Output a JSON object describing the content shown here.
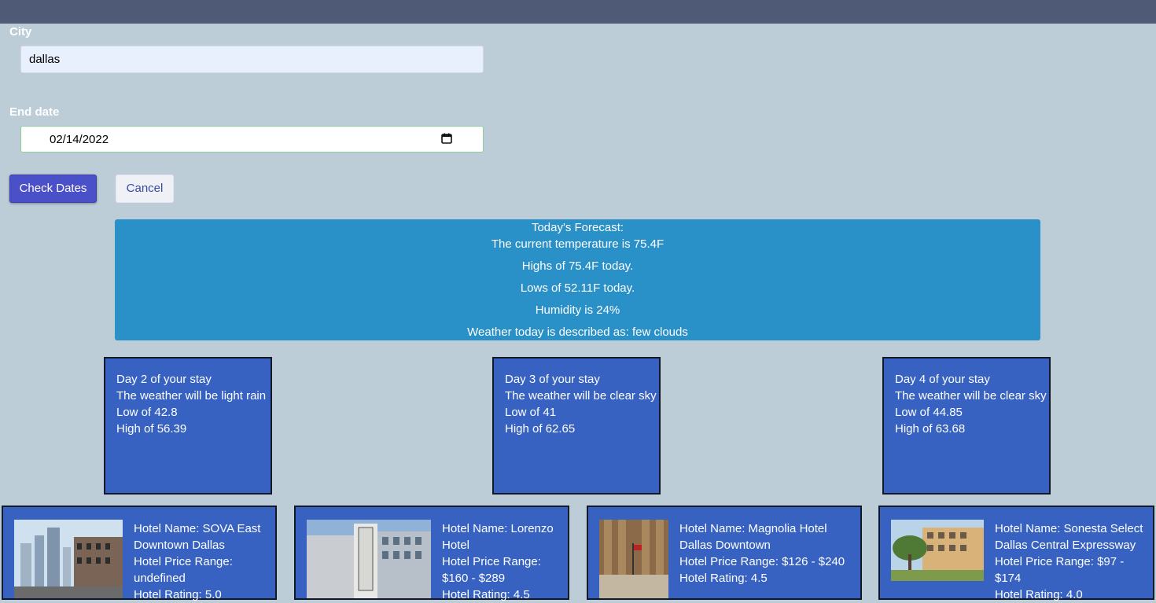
{
  "form": {
    "city_label": "City",
    "city_value": "dallas",
    "end_date_label": "End date",
    "end_date_value": "02/14/2022",
    "check_button": "Check Dates",
    "cancel_button": "Cancel"
  },
  "forecast": {
    "title": "Today's Forecast:",
    "current": "The current temperature is 75.4F",
    "highs": "Highs of 75.4F today.",
    "lows": "Lows of 52.11F today.",
    "humidity": "Humidity is 24%",
    "description": "Weather today is described as: few clouds"
  },
  "days": [
    {
      "title": "Day 2 of your stay",
      "weather": "The weather will be light rain",
      "low": "Low of 42.8",
      "high": "High of 56.39"
    },
    {
      "title": "Day 3 of your stay",
      "weather": "The weather will be clear sky",
      "low": "Low of 41",
      "high": "High of 62.65"
    },
    {
      "title": "Day 4 of your stay",
      "weather": "The weather will be clear sky",
      "low": "Low of 44.85",
      "high": "High of 63.68"
    }
  ],
  "hotels": [
    {
      "name_lines": [
        "Hotel Name: SOVA East",
        "Downtown Dallas"
      ],
      "price_lines": [
        "Hotel Price Range:",
        "undefined"
      ],
      "rating": "Hotel Rating: 5.0"
    },
    {
      "name_lines": [
        "Hotel Name: Lorenzo",
        "Hotel"
      ],
      "price_lines": [
        "Hotel Price Range:",
        "$160 - $289"
      ],
      "rating": "Hotel Rating: 4.5"
    },
    {
      "name_lines": [
        "Hotel Name: Magnolia Hotel",
        "Dallas Downtown"
      ],
      "price_lines": [
        "Hotel Price Range: $126 - $240"
      ],
      "rating": "Hotel Rating: 4.5"
    },
    {
      "name_lines": [
        "Hotel Name: Sonesta Select",
        "Dallas Central Expressway"
      ],
      "price_lines": [
        "Hotel Price Range: $97 -",
        "$174"
      ],
      "rating": "Hotel Rating: 4.0"
    }
  ],
  "colors": {
    "page_bg": "#bccdd8",
    "top_bar": "#4f5b76",
    "forecast_bg": "#2a90c8",
    "card_bg": "#3762c2",
    "primary_button": "#4a50c8"
  },
  "icons": {
    "date_picker": "calendar-icon"
  }
}
